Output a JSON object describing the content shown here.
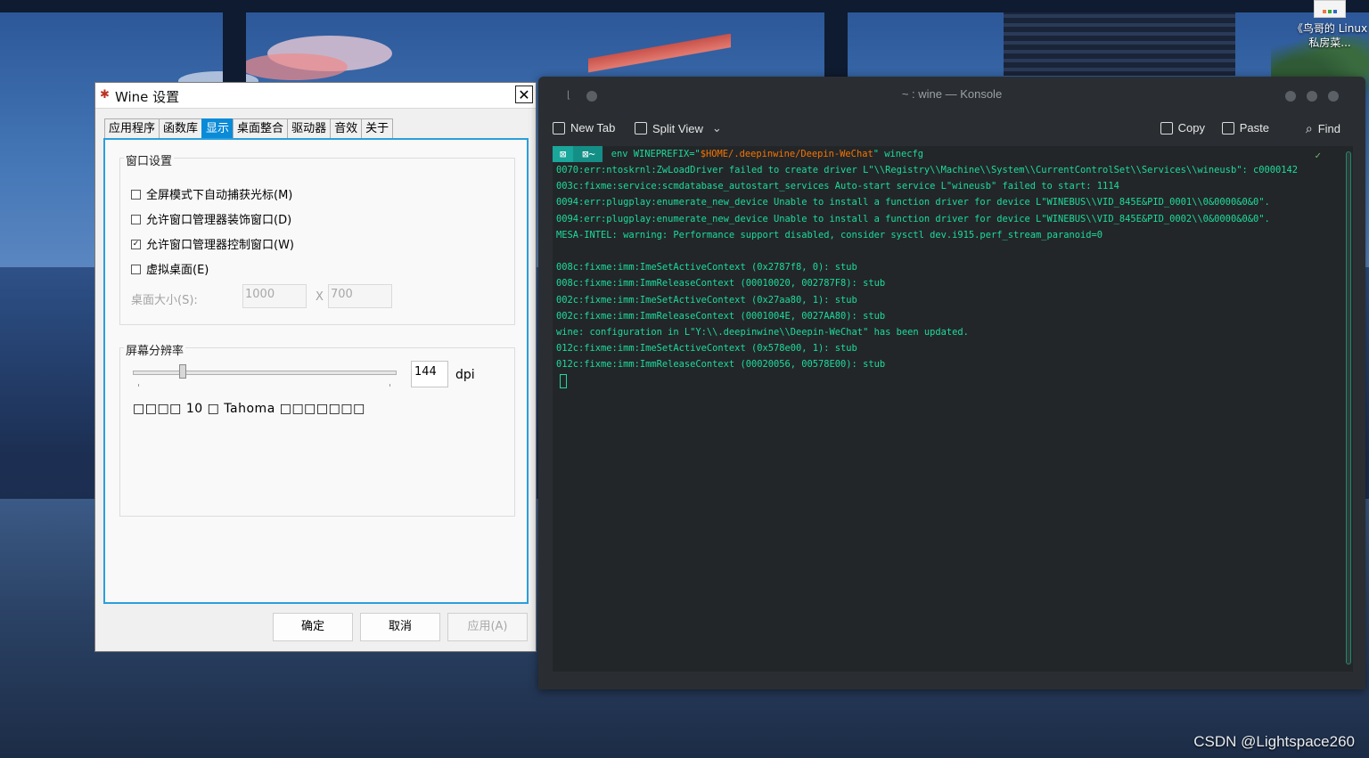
{
  "desktop": {
    "icon_label": "《鸟哥的 Linux私房菜...",
    "watermark": "CSDN @Lightspace260"
  },
  "wine": {
    "title": "Wine 设置",
    "close_symbol": "✕",
    "tabs": [
      "应用程序",
      "函数库",
      "显示",
      "桌面整合",
      "驱动器",
      "音效",
      "关于"
    ],
    "active_tab": "显示",
    "window_group": {
      "title": "窗口设置",
      "checkboxes": [
        {
          "label": "全屏模式下自动捕获光标(M)",
          "checked": false
        },
        {
          "label": "允许窗口管理器装饰窗口(D)",
          "checked": false
        },
        {
          "label": "允许窗口管理器控制窗口(W)",
          "checked": true
        },
        {
          "label": "虚拟桌面(E)",
          "checked": false
        }
      ],
      "desktop_size_label": "桌面大小(S):",
      "width": "1000",
      "x_sep": "X",
      "height": "700"
    },
    "resolution_group": {
      "title": "屏幕分辨率",
      "dpi_value": "144",
      "dpi_unit": "dpi",
      "sample_text": "□□□□ 10 □ Tahoma □□□□□□□"
    },
    "buttons": {
      "ok": "确定",
      "cancel": "取消",
      "apply": "应用(A)"
    }
  },
  "konsole": {
    "title": "~ : wine — Konsole",
    "toolbar": {
      "new_tab": "New Tab",
      "split_view": "Split View",
      "copy": "Copy",
      "paste": "Paste",
      "find": "Find"
    },
    "prompt": {
      "seg1": "⊠",
      "seg2": "⊠~",
      "cmd_before": "env WINEPREFIX=\"",
      "cmd_var": "$HOME/.deepinwine/Deepin-WeChat",
      "cmd_after": "\" winecfg",
      "status": "✓"
    },
    "output": [
      "0070:err:ntoskrnl:ZwLoadDriver failed to create driver L\"\\\\Registry\\\\Machine\\\\System\\\\CurrentControlSet\\\\Services\\\\wineusb\": c0000142",
      "003c:fixme:service:scmdatabase_autostart_services Auto-start service L\"wineusb\" failed to start: 1114",
      "0094:err:plugplay:enumerate_new_device Unable to install a function driver for device L\"WINEBUS\\\\VID_845E&PID_0001\\\\0&0000&0&0\".",
      "0094:err:plugplay:enumerate_new_device Unable to install a function driver for device L\"WINEBUS\\\\VID_845E&PID_0002\\\\0&0000&0&0\".",
      "MESA-INTEL: warning: Performance support disabled, consider sysctl dev.i915.perf_stream_paranoid=0",
      "",
      "008c:fixme:imm:ImeSetActiveContext (0x2787f8, 0): stub",
      "008c:fixme:imm:ImmReleaseContext (00010020, 002787F8): stub",
      "002c:fixme:imm:ImeSetActiveContext (0x27aa80, 1): stub",
      "002c:fixme:imm:ImmReleaseContext (0001004E, 0027AA80): stub",
      "wine: configuration in L\"Y:\\\\.deepinwine\\\\Deepin-WeChat\" has been updated.",
      "012c:fixme:imm:ImeSetActiveContext (0x578e00, 1): stub",
      "012c:fixme:imm:ImmReleaseContext (00020056, 00578E00): stub"
    ]
  }
}
